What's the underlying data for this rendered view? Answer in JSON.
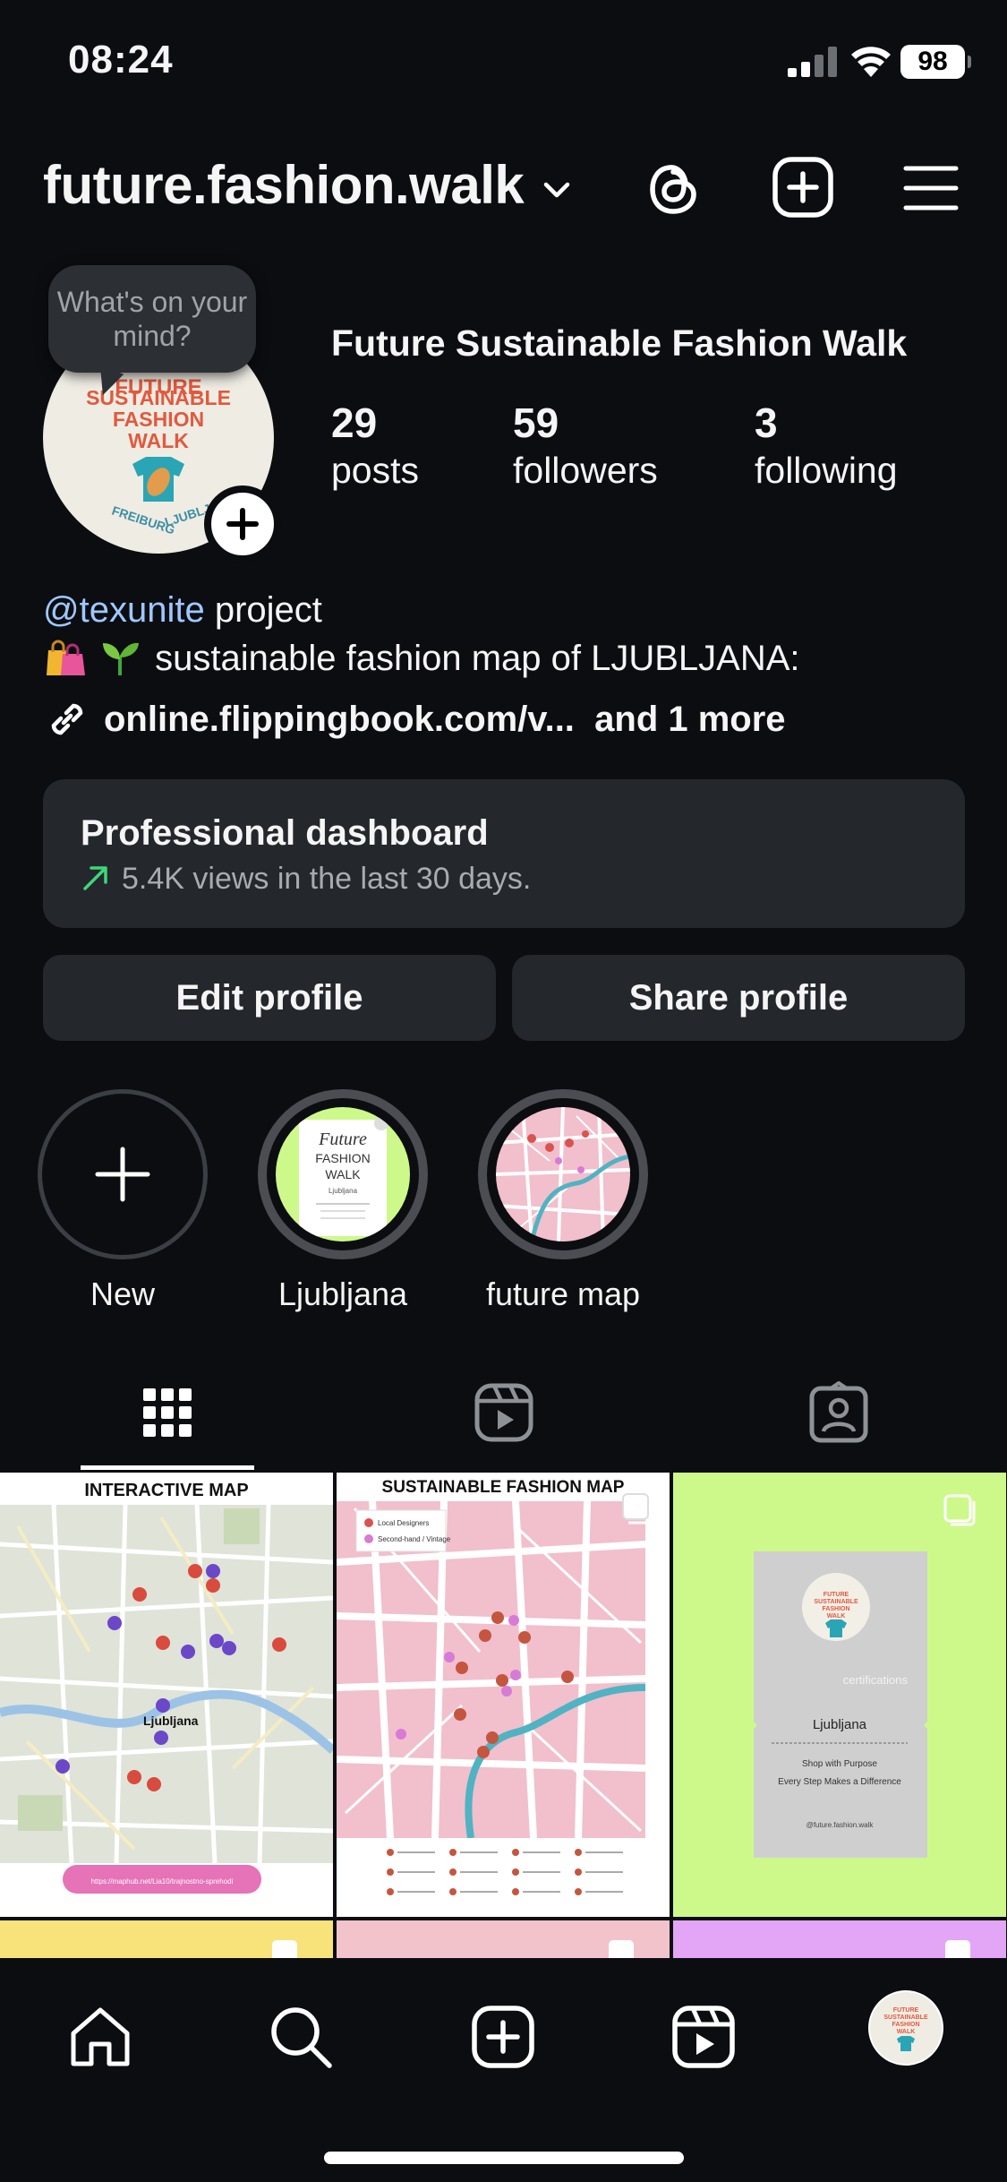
{
  "status": {
    "time": "08:24",
    "battery": "98"
  },
  "header": {
    "username": "future.fashion.walk"
  },
  "profile": {
    "note_bubble": "What's on your mind?",
    "display_name": "Future Sustainable Fashion Walk",
    "avatar_text": [
      "FUTURE",
      "SUSTAINABLE",
      "FASHION",
      "WALK",
      "FREIBURG",
      "LJUBLJANA"
    ],
    "stats": [
      {
        "value": "29",
        "label": "posts"
      },
      {
        "value": "59",
        "label": "followers"
      },
      {
        "value": "3",
        "label": "following"
      }
    ],
    "bio_mention": "@texunite",
    "bio_line1_rest": " project",
    "bio_line2": "sustainable fashion map of LJUBLJANA:",
    "link_text": "online.flippingbook.com/v...",
    "link_more": "and 1 more"
  },
  "dashboard": {
    "title": "Professional dashboard",
    "subtitle": "5.4K views in the last 30 days."
  },
  "buttons": {
    "edit": "Edit profile",
    "share": "Share profile"
  },
  "highlights": [
    {
      "label": "New"
    },
    {
      "label": "Ljubljana",
      "thumb_title_1": "Future",
      "thumb_title_2": "FASHION",
      "thumb_title_3": "WALK",
      "thumb_sub": "Ljubljana"
    },
    {
      "label": "future map"
    }
  ],
  "tabs": [
    "grid-icon",
    "reels-icon",
    "tagged-icon"
  ],
  "grid": {
    "post1_title": "INTERACTIVE MAP",
    "post1_city": "Ljubljana",
    "post1_link": "https://maphub.net/Lia10/trajnostno-sprehodi",
    "post2_title": "SUSTAINABLE FASHION MAP",
    "post2_legend": [
      "Local Designers",
      "Second-hand / Vintage"
    ],
    "post3_logo": [
      "FUTURE",
      "SUSTAINABLE",
      "FASHION",
      "WALK"
    ],
    "post3_city": "Ljubljana",
    "post3_tag": "certifications",
    "post3_line1": "Shop with Purpose",
    "post3_line2": "Every Step Makes a Difference",
    "post3_handle": "@future.fashion.walk"
  },
  "colors": {
    "accent_lime": "#cdf98a",
    "pink_map": "#f2bfcc",
    "yellow": "#f8e27a",
    "purple": "#e3a6f7",
    "link_blue": "#9ec8ff",
    "trend_green": "#3fd67a"
  },
  "nav": [
    "home-icon",
    "search-icon",
    "create-icon",
    "reels-icon",
    "profile-avatar"
  ]
}
